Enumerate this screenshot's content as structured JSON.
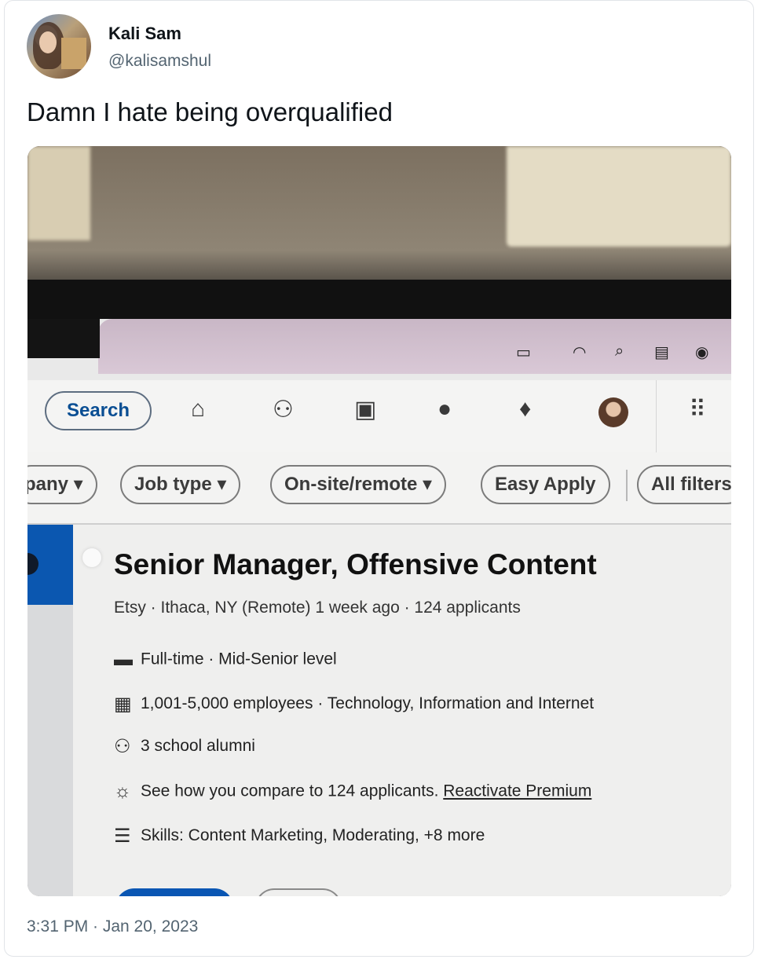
{
  "tweet": {
    "display_name": "Kali Sam",
    "handle": "@kalisamshul",
    "text": "Damn I hate being overqualified",
    "timestamp": "3:31 PM · Jan 20, 2023"
  },
  "photo": {
    "menubar_icons": [
      "battery-charging-icon",
      "wifi-icon",
      "search-icon",
      "control-center-icon",
      "siri-icon"
    ],
    "navbar": {
      "search_label": "Search",
      "icons": [
        "home-icon",
        "my-network-icon",
        "jobs-icon",
        "messaging-icon",
        "notifications-icon",
        "profile-avatar",
        "apps-grid-icon"
      ]
    },
    "filters": [
      "pany ▾",
      "Job type ▾",
      "On-site/remote ▾",
      "Easy Apply",
      "All filters"
    ],
    "job": {
      "title": "Senior Manager, Offensive Content",
      "meta": "Etsy · Ithaca, NY (Remote) 1 week ago · 124 applicants",
      "rows": [
        {
          "icon": "briefcase-icon",
          "text": "Full-time · Mid-Senior level"
        },
        {
          "icon": "building-icon",
          "text": "1,001-5,000 employees · Technology, Information and Internet"
        },
        {
          "icon": "people-icon",
          "text": "3 school alumni"
        },
        {
          "icon": "lightbulb-icon",
          "text": "See how you compare to 124 applicants.",
          "link": "Reactivate Premium"
        },
        {
          "icon": "checklist-icon",
          "text": "Skills: Content Marketing, Moderating, +8 more"
        }
      ]
    }
  }
}
